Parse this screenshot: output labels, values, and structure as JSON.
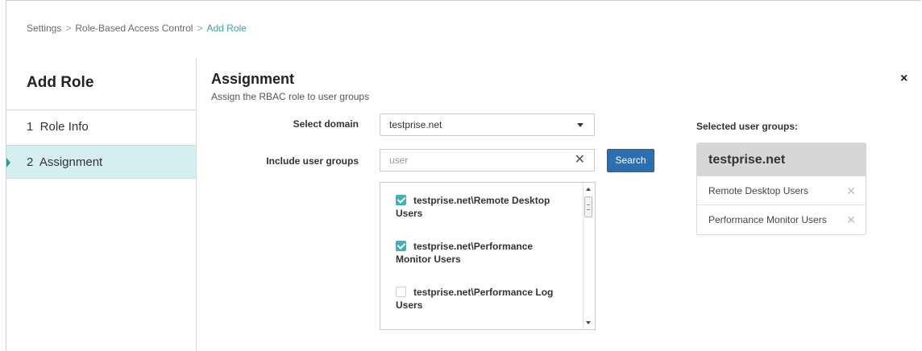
{
  "breadcrumb": [
    "Settings",
    "Role-Based Access Control",
    "Add Role"
  ],
  "breadcrumb_sep": ">",
  "sidebar": {
    "title": "Add Role",
    "items": [
      {
        "label": "1  Role Info"
      },
      {
        "label": "2  Assignment"
      }
    ]
  },
  "section": {
    "title": "Assignment",
    "subtitle": "Assign the RBAC role to user groups",
    "close_icon": "×"
  },
  "form": {
    "domain_label": "Select domain",
    "domain_value": "testprise.net",
    "groups_label": "Include user groups",
    "groups_value": "user",
    "clear_icon": "✕",
    "search_button": "Search"
  },
  "results": [
    {
      "line1": "testprise.net\\Remote Desktop",
      "line2": "Users",
      "checked": true
    },
    {
      "line1": "testprise.net\\Performance",
      "line2": "Monitor Users",
      "checked": true
    },
    {
      "line1": "testprise.net\\Performance Log",
      "line2": "Users",
      "checked": false
    }
  ],
  "selected": {
    "label": "Selected user groups:",
    "domain": "testprise.net",
    "items": [
      "Remote Desktop Users",
      "Performance Monitor Users"
    ],
    "remove_icon": "✕"
  },
  "colors": {
    "accent": "#3aa3a3",
    "active_bg": "#d4efed",
    "checkbox": "#3bb3b8",
    "button": "#2b6fb0"
  }
}
